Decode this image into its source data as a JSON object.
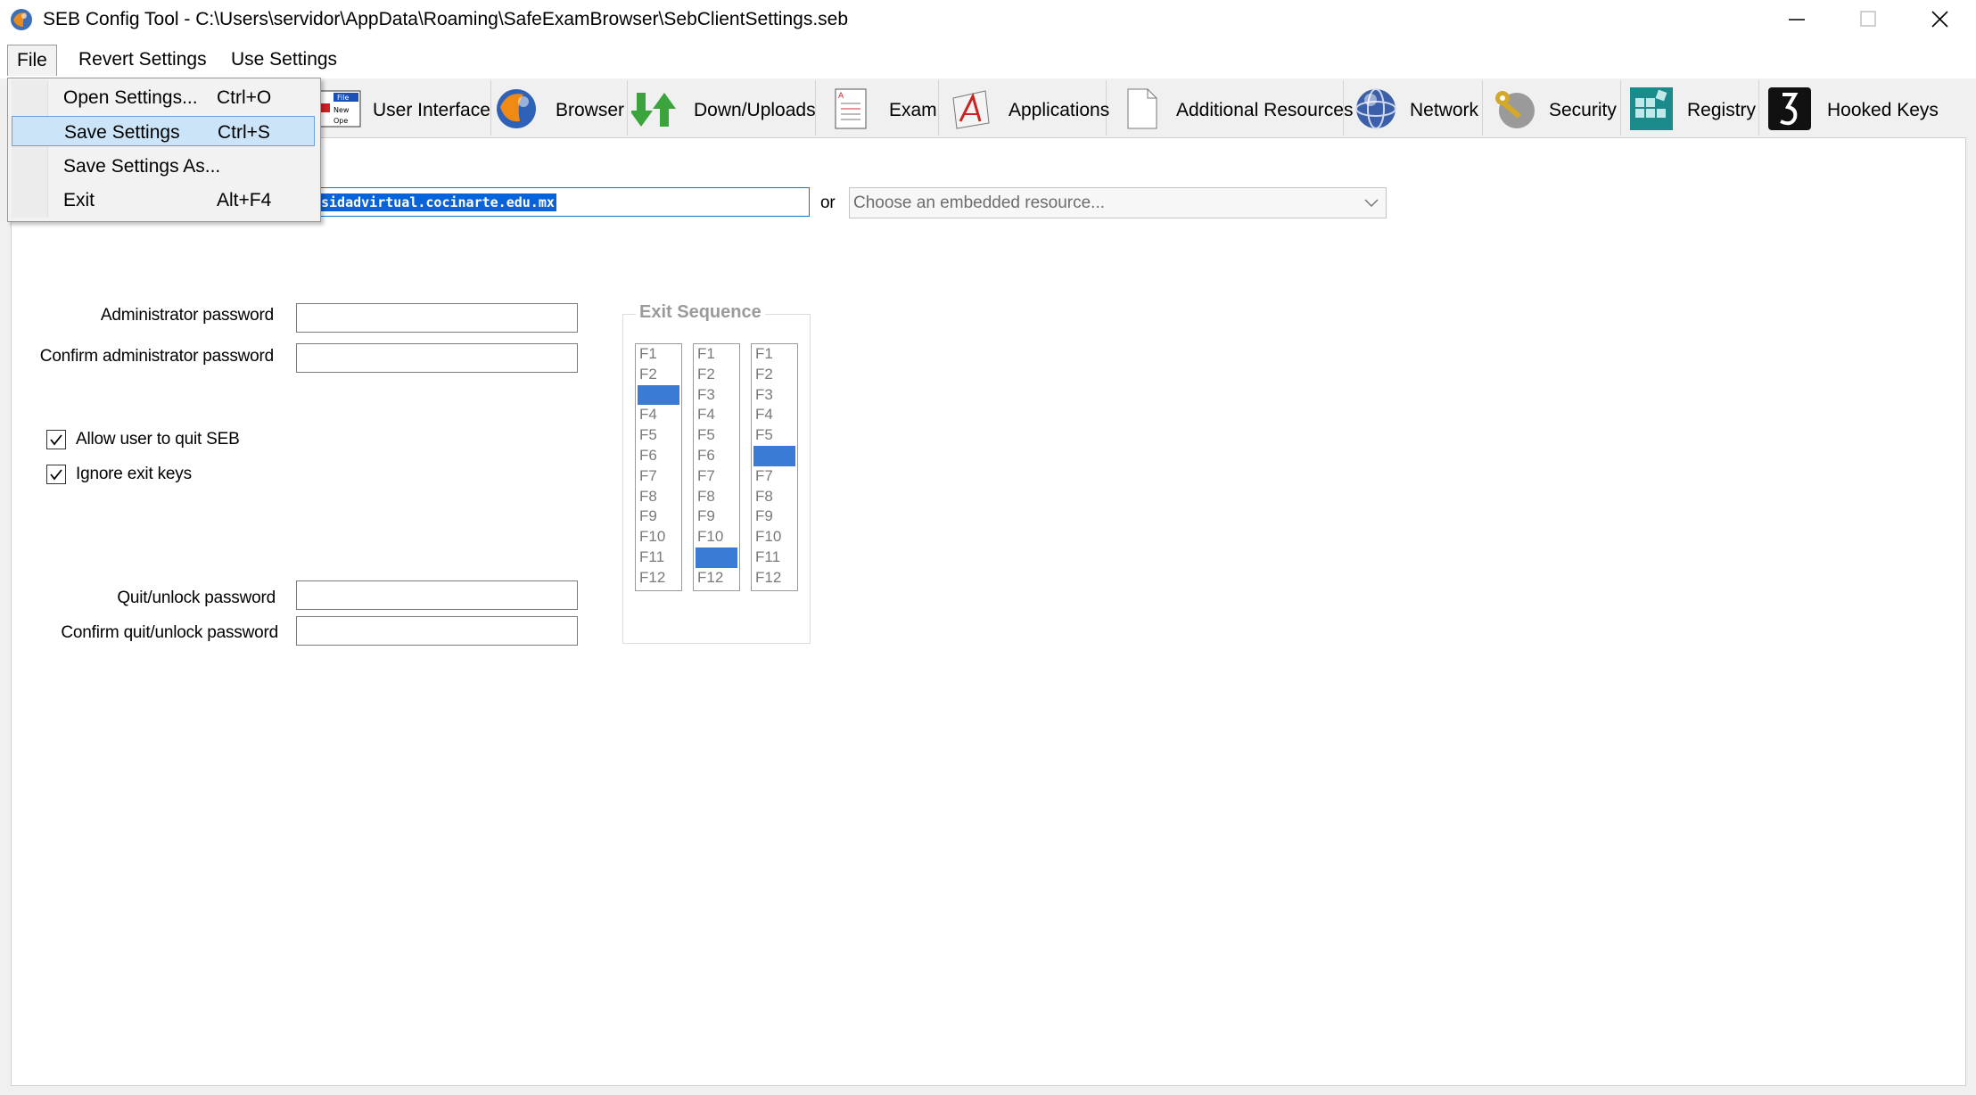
{
  "window": {
    "title": "SEB Config Tool - C:\\Users\\servidor\\AppData\\Roaming\\SafeExamBrowser\\SebClientSettings.seb"
  },
  "menubar": {
    "file": "File",
    "revert": "Revert Settings",
    "use": "Use Settings"
  },
  "file_menu": {
    "items": [
      {
        "label": "Open Settings...",
        "shortcut": "Ctrl+O"
      },
      {
        "label": "Save Settings",
        "shortcut": "Ctrl+S"
      },
      {
        "label": "Save Settings As...",
        "shortcut": ""
      },
      {
        "label": "Exit",
        "shortcut": "Alt+F4"
      }
    ],
    "highlighted_index": 1
  },
  "toolbar": {
    "tabs": [
      {
        "label": "User Interface",
        "icon": "user-interface-icon"
      },
      {
        "label": "Browser",
        "icon": "browser-globe-icon"
      },
      {
        "label": "Down/Uploads",
        "icon": "down-uploads-arrows-icon"
      },
      {
        "label": "Exam",
        "icon": "exam-document-icon"
      },
      {
        "label": "Applications",
        "icon": "applications-icon"
      },
      {
        "label": "Additional Resources",
        "icon": "blank-page-icon"
      },
      {
        "label": "Network",
        "icon": "network-globe-icon"
      },
      {
        "label": "Security",
        "icon": "security-keys-icon"
      },
      {
        "label": "Registry",
        "icon": "registry-icon"
      },
      {
        "label": "Hooked Keys",
        "icon": "hooked-keys-icon"
      }
    ]
  },
  "general": {
    "start_url_selected": "sidadvirtual.cocinarte.edu.mx",
    "or": "or",
    "embedded_placeholder": "Choose an embedded resource...",
    "admin_password_label": "Administrator password",
    "confirm_admin_password_label": "Confirm administrator password",
    "allow_quit_label": "Allow user to quit SEB",
    "allow_quit_checked": true,
    "ignore_exit_keys_label": "Ignore exit keys",
    "ignore_exit_keys_checked": true,
    "quit_password_label": "Quit/unlock password",
    "confirm_quit_password_label": "Confirm quit/unlock password"
  },
  "exit_sequence": {
    "title": "Exit Sequence",
    "keys": [
      "F1",
      "F2",
      "F3",
      "F4",
      "F5",
      "F6",
      "F7",
      "F8",
      "F9",
      "F10",
      "F11",
      "F12"
    ],
    "selected": [
      "F3",
      "F11",
      "F6"
    ]
  },
  "colors": {
    "selection": "#3a7bd5",
    "menu_highlight": "#cce4f7"
  }
}
